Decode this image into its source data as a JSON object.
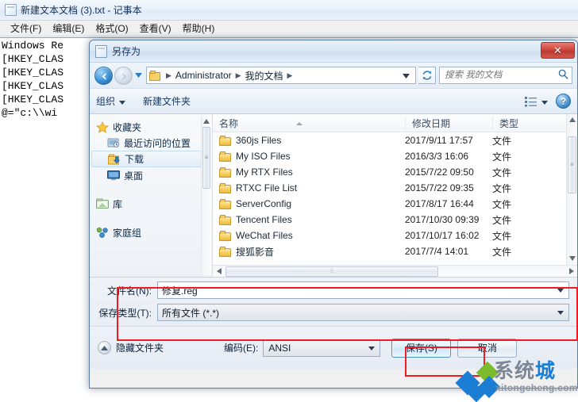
{
  "notepad": {
    "title": "新建文本文档 (3).txt - 记事本",
    "icon": "notepad-icon",
    "menus": [
      {
        "label": "文件(F)"
      },
      {
        "label": "编辑(E)"
      },
      {
        "label": "格式(O)"
      },
      {
        "label": "查看(V)"
      },
      {
        "label": "帮助(H)"
      }
    ],
    "text_lines": [
      "Windows Re",
      "[HKEY_CLAS",
      "[HKEY_CLAS",
      "[HKEY_CLAS",
      "[HKEY_CLAS",
      "@=\"c:\\\\wi"
    ]
  },
  "dialog": {
    "title": "另存为",
    "icon": "notepad-icon",
    "close_label": "✕",
    "nav": {
      "back_icon": "arrow-left-icon",
      "forward_icon": "arrow-right-icon",
      "history_icon": "chevron-down-icon",
      "refresh_icon": "refresh-icon",
      "breadcrumb": [
        {
          "label": "Administrator"
        },
        {
          "label": "我的文档"
        }
      ],
      "breadcrumb_caret": "chevron-down-icon",
      "search": {
        "placeholder": "搜索 我的文档",
        "value": "",
        "icon": "search-icon"
      }
    },
    "toolbar": {
      "organize_label": "组织",
      "new_folder_label": "新建文件夹",
      "view_icon": "list-view-icon",
      "help_icon": "help-icon",
      "help_label": "?"
    },
    "sidebar": [
      {
        "label": "收藏夹",
        "icon": "star-icon",
        "level": "root",
        "selected": false
      },
      {
        "label": "最近访问的位置",
        "icon": "recent-places-icon",
        "level": "child",
        "selected": false
      },
      {
        "label": "下载",
        "icon": "downloads-folder-icon",
        "level": "child",
        "selected": true
      },
      {
        "label": "桌面",
        "icon": "desktop-icon",
        "level": "child",
        "selected": false
      },
      {
        "label": "库",
        "icon": "library-icon",
        "level": "root",
        "selected": false
      },
      {
        "label": "家庭组",
        "icon": "homegroup-icon",
        "level": "root",
        "selected": false
      }
    ],
    "filelist": {
      "columns": [
        {
          "label": "名称",
          "sorted": true
        },
        {
          "label": "修改日期",
          "sorted": false
        },
        {
          "label": "类型",
          "sorted": false
        }
      ],
      "rows": [
        {
          "name": "360js Files",
          "date": "2017/9/11 17:57",
          "type": "文件"
        },
        {
          "name": "My ISO Files",
          "date": "2016/3/3 16:06",
          "type": "文件"
        },
        {
          "name": "My RTX Files",
          "date": "2015/7/22 09:50",
          "type": "文件"
        },
        {
          "name": "RTXC File List",
          "date": "2015/7/22 09:35",
          "type": "文件"
        },
        {
          "name": "ServerConfig",
          "date": "2017/8/17 16:44",
          "type": "文件"
        },
        {
          "name": "Tencent Files",
          "date": "2017/10/30 09:39",
          "type": "文件"
        },
        {
          "name": "WeChat Files",
          "date": "2017/10/17 16:02",
          "type": "文件"
        },
        {
          "name": "搜狐影音",
          "date": "2017/7/4 14:01",
          "type": "文件"
        }
      ]
    },
    "fields": {
      "filename_label": "文件名(N):",
      "filename_value": "修复.reg",
      "filetype_label": "保存类型(T):",
      "filetype_value": "所有文件  (*.*)"
    },
    "footer": {
      "hide_folders_label": "隐藏文件夹",
      "hide_folders_icon": "chevron-up-icon",
      "encoding_label": "编码(E):",
      "encoding_value": "ANSI",
      "save_label": "保存(S)",
      "cancel_label": "取消"
    }
  },
  "annotations": {
    "highlight_color": "#ee1c22",
    "boxes": [
      {
        "name": "fields-highlight"
      },
      {
        "name": "save-button-highlight"
      }
    ]
  },
  "watermark": {
    "text_gray": "系统",
    "text_blue": "城",
    "url": "xitongcheng.com"
  }
}
